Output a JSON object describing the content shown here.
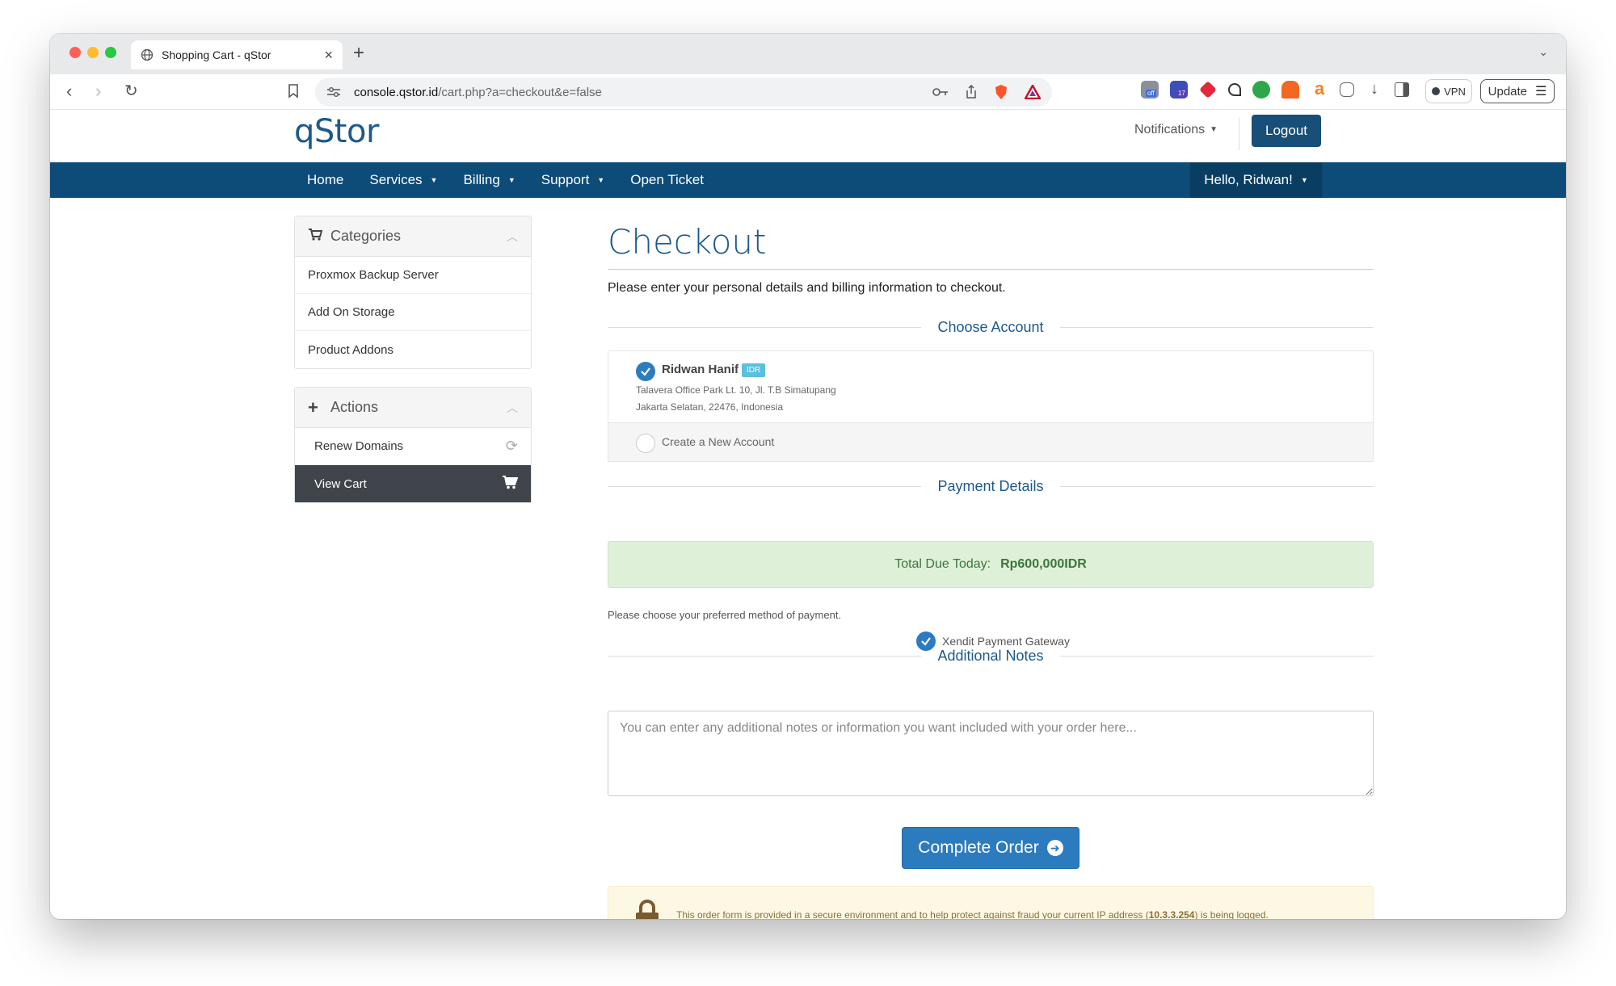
{
  "browser": {
    "tab_title": "Shopping Cart - qStor",
    "url_domain": "console.qstor.id",
    "url_path": "/cart.php?a=checkout&e=false",
    "vpn_label": "VPN",
    "update_label": "Update",
    "extension_badges": [
      "off",
      "17"
    ]
  },
  "header": {
    "logo": "qStor",
    "notifications": "Notifications",
    "logout": "Logout",
    "brand_color": "#0d4b78"
  },
  "nav": {
    "home": "Home",
    "services": "Services",
    "billing": "Billing",
    "support": "Support",
    "open_ticket": "Open Ticket",
    "user_menu": "Hello, Ridwan!"
  },
  "sidebar": {
    "categories": {
      "title": "Categories",
      "items": [
        "Proxmox Backup Server",
        "Add On Storage",
        "Product Addons"
      ]
    },
    "actions": {
      "title": "Actions",
      "items": [
        "Renew Domains",
        "View Cart"
      ]
    }
  },
  "main": {
    "title": "Checkout",
    "intro": "Please enter your personal details and billing information to checkout.",
    "choose_account": "Choose Account",
    "account": {
      "name": "Ridwan Hanif",
      "currency": "IDR",
      "address_line1": "Talavera Office Park Lt. 10, Jl. T.B Simatupang",
      "address_line2": "Jakarta Selatan, 22476, Indonesia"
    },
    "new_account": "Create a New Account",
    "payment_details": "Payment Details",
    "total_label": "Total Due Today:",
    "total_amount": "Rp600,000IDR",
    "choose_method": "Please choose your preferred method of payment.",
    "gateway": "Xendit Payment Gateway",
    "additional_notes": "Additional Notes",
    "notes_placeholder": "You can enter any additional notes or information you want included with your order here...",
    "complete_order": "Complete Order",
    "secure_msg_before": "This order form is provided in a secure environment and to help protect against fraud your current IP address (",
    "ip_address": "10.3.3.254",
    "secure_msg_after": ") is being logged."
  }
}
